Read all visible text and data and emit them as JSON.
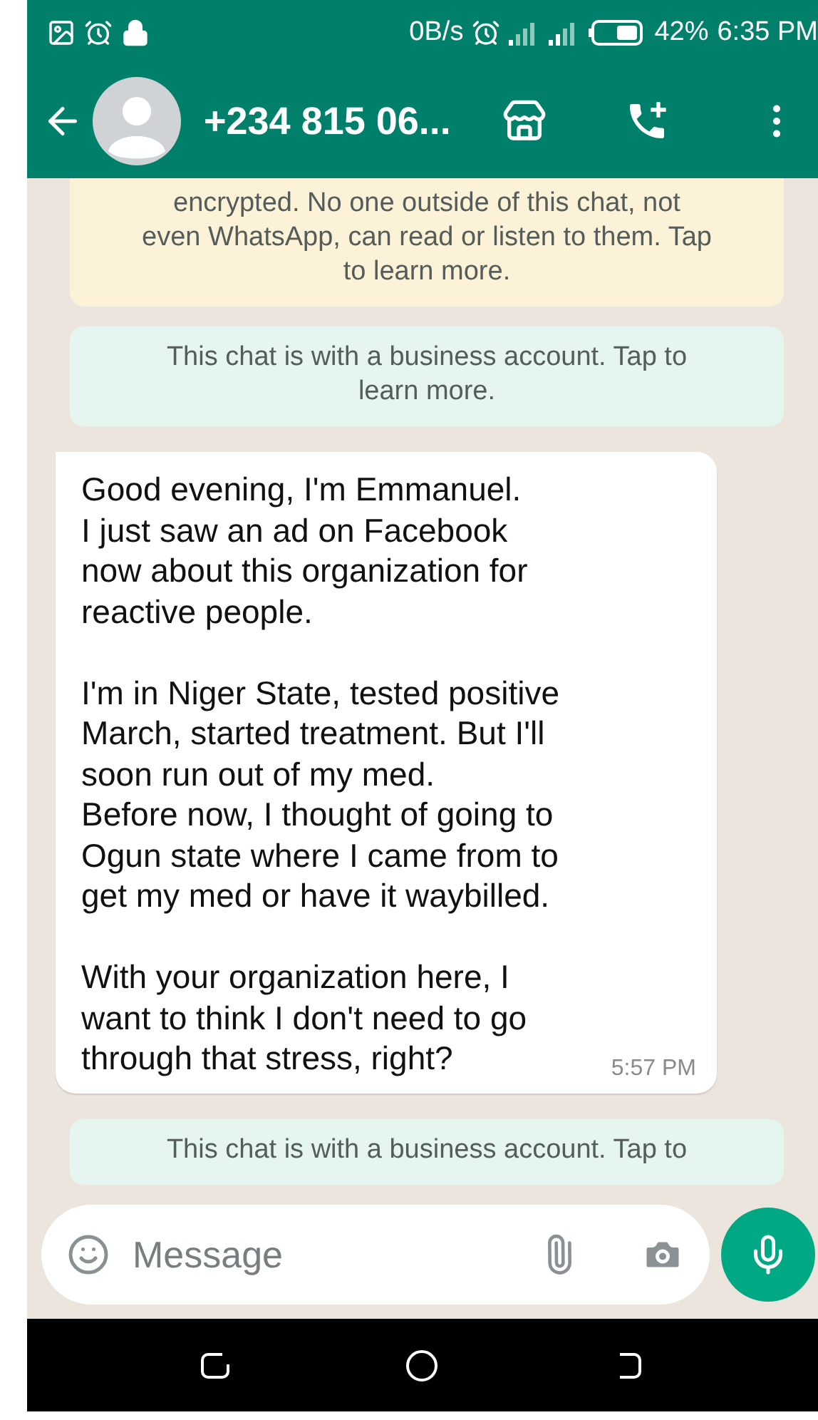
{
  "status_bar": {
    "speed": "0B/s",
    "battery_percent": "42%",
    "time": "6:35 PM"
  },
  "header": {
    "title": "+234 815 06..."
  },
  "chat": [
    {
      "kind": "encryption",
      "text": "encrypted. No one outside of this chat, not\neven WhatsApp, can read or listen to them. Tap\nto learn more."
    },
    {
      "kind": "business",
      "text": "This chat is with a business account. Tap to\nlearn more."
    },
    {
      "kind": "incoming",
      "text": "Good evening, I'm Emmanuel.\nI just saw an ad on Facebook\nnow about this organization for\nreactive people.\n\nI'm in Niger State, tested positive\nMarch, started treatment. But I'll\nsoon run out of my med.\nBefore now, I thought of going to\nOgun state where I came from to\nget my med or have it waybilled.\n\nWith your organization here, I\nwant to think I don't need to go\nthrough that stress, right?",
      "time": "5:57 PM"
    },
    {
      "kind": "business",
      "text": "This chat is with a business account. Tap to"
    }
  ],
  "composer": {
    "placeholder": "Message"
  }
}
